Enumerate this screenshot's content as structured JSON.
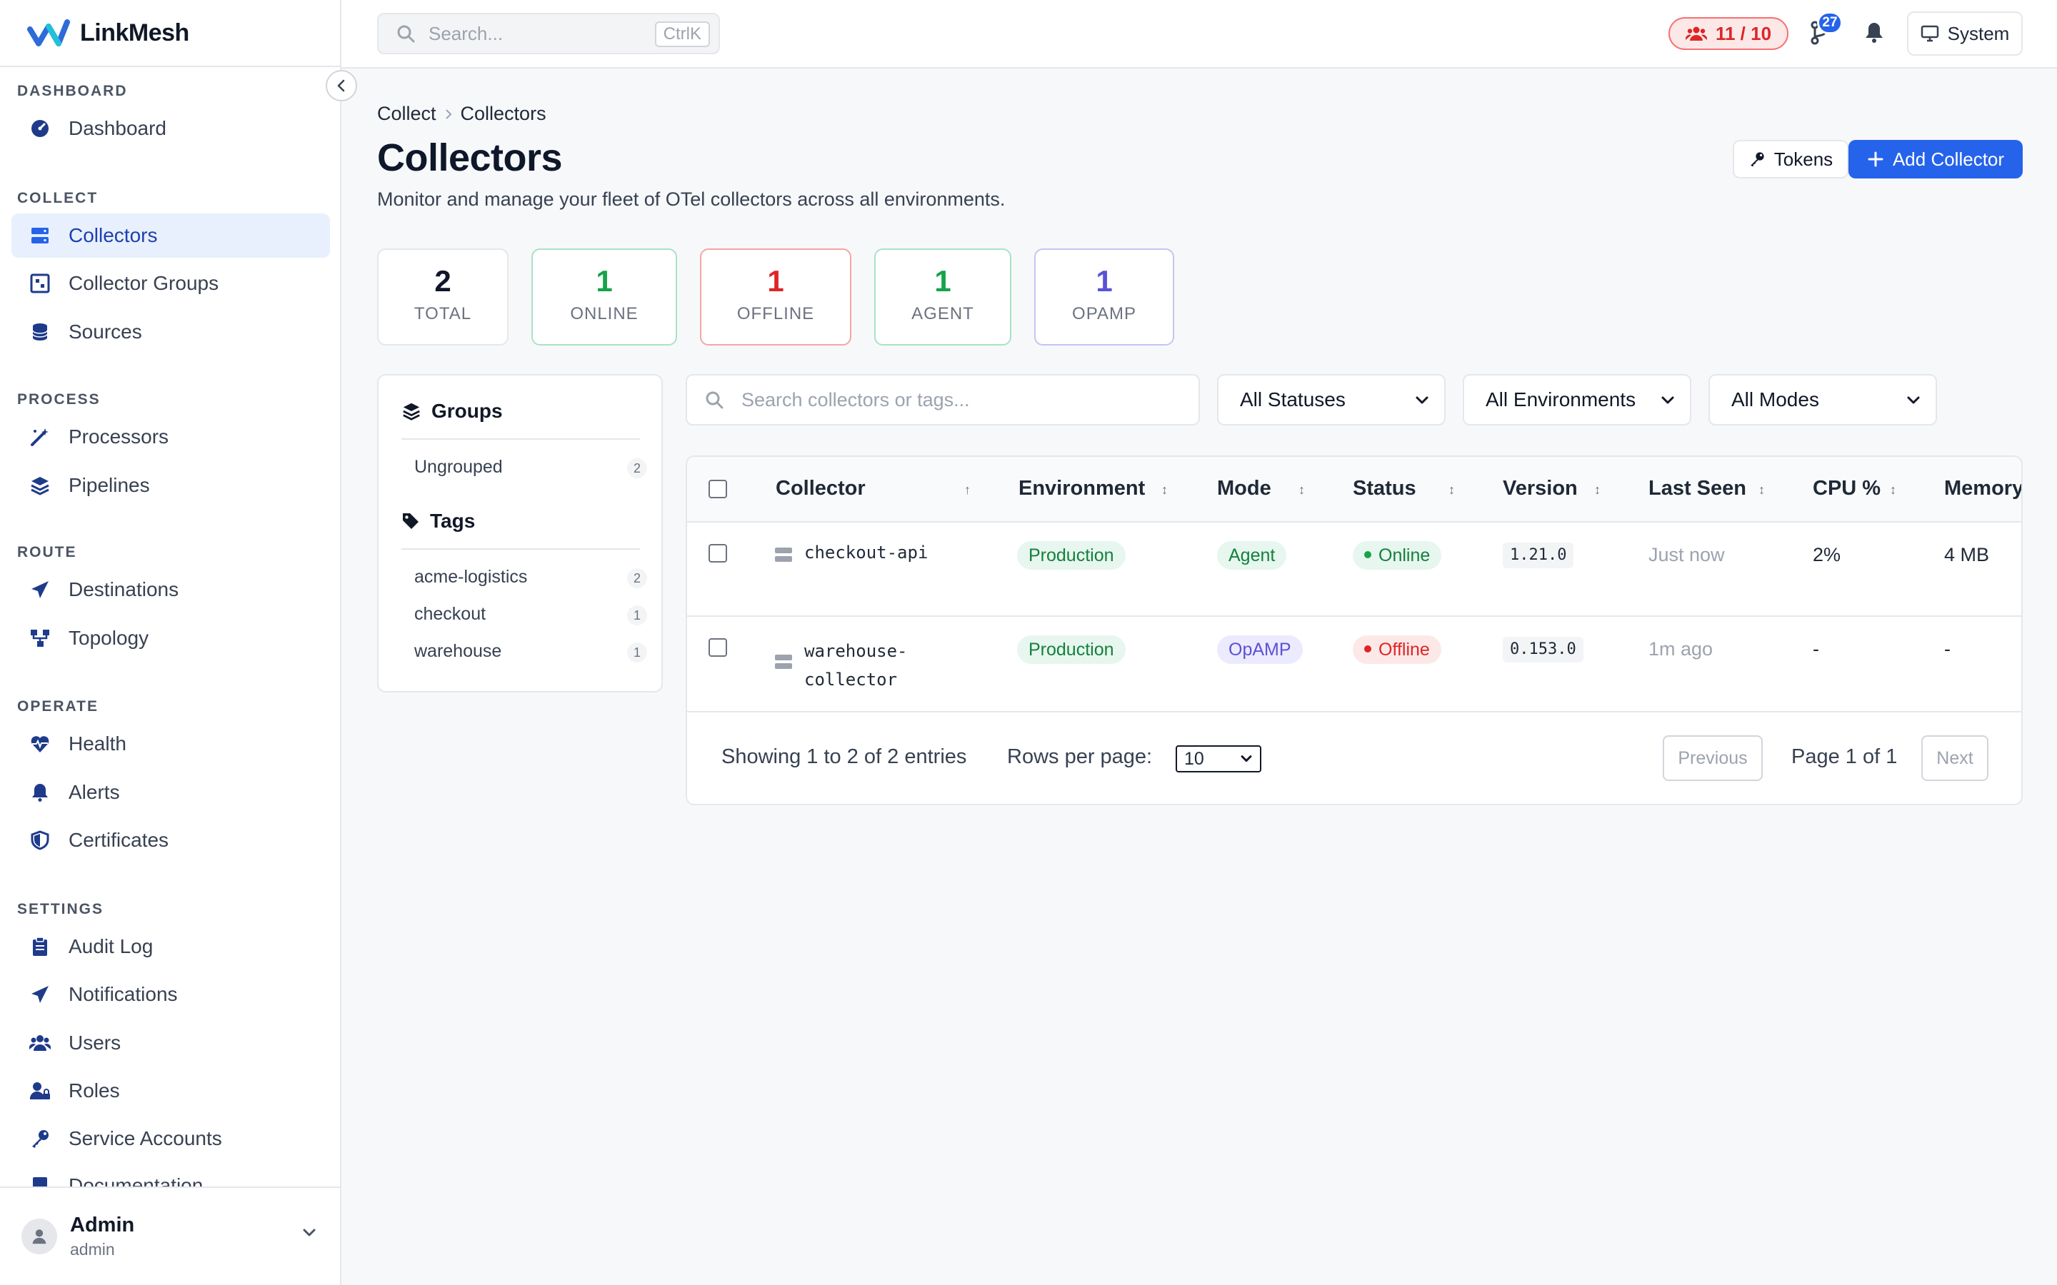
{
  "brand": {
    "name": "LinkMesh"
  },
  "sidebar": {
    "sections": [
      {
        "label": "DASHBOARD"
      },
      {
        "label": "COLLECT"
      },
      {
        "label": "PROCESS"
      },
      {
        "label": "ROUTE"
      },
      {
        "label": "OPERATE"
      },
      {
        "label": "SETTINGS"
      }
    ],
    "items": [
      {
        "label": "Dashboard",
        "icon": "gauge-icon"
      },
      {
        "label": "Collectors",
        "icon": "server-icon",
        "active": true
      },
      {
        "label": "Collector Groups",
        "icon": "group-icon"
      },
      {
        "label": "Sources",
        "icon": "database-icon"
      },
      {
        "label": "Processors",
        "icon": "wand-icon"
      },
      {
        "label": "Pipelines",
        "icon": "layers-icon"
      },
      {
        "label": "Destinations",
        "icon": "paper-plane-icon"
      },
      {
        "label": "Topology",
        "icon": "topology-icon"
      },
      {
        "label": "Health",
        "icon": "heartbeat-icon"
      },
      {
        "label": "Alerts",
        "icon": "bell-icon"
      },
      {
        "label": "Certificates",
        "icon": "shield-icon"
      },
      {
        "label": "Audit Log",
        "icon": "clipboard-icon"
      },
      {
        "label": "Notifications",
        "icon": "paper-plane-icon"
      },
      {
        "label": "Users",
        "icon": "users-icon"
      },
      {
        "label": "Roles",
        "icon": "user-lock-icon"
      },
      {
        "label": "Service Accounts",
        "icon": "key-icon"
      },
      {
        "label": "Documentation",
        "icon": "book-icon"
      }
    ],
    "user": {
      "name": "Admin",
      "sub": "admin"
    }
  },
  "topbar": {
    "search_placeholder": "Search...",
    "search_shortcut": "CtrlK",
    "license": "11 / 10",
    "badge_count": "27",
    "system_label": "System"
  },
  "breadcrumb": {
    "parent": "Collect",
    "current": "Collectors"
  },
  "page": {
    "title": "Collectors",
    "subtitle": "Monitor and manage your fleet of OTel collectors across all environments.",
    "tokens_label": "Tokens",
    "add_label": "Add Collector"
  },
  "stats": [
    {
      "value": "2",
      "label": "TOTAL",
      "color": "#0f172a",
      "border": "#e5e7eb"
    },
    {
      "value": "1",
      "label": "ONLINE",
      "color": "#16a34a",
      "border": "#a7e3c4"
    },
    {
      "value": "1",
      "label": "OFFLINE",
      "color": "#dc2626",
      "border": "#f5a5a5"
    },
    {
      "value": "1",
      "label": "AGENT",
      "color": "#16a34a",
      "border": "#a7e3c4"
    },
    {
      "value": "1",
      "label": "OPAMP",
      "color": "#5b52d6",
      "border": "#c7c3f2"
    }
  ],
  "groups_panel": {
    "groups_title": "Groups",
    "groups": [
      {
        "name": "Ungrouped",
        "count": "2"
      }
    ],
    "tags_title": "Tags",
    "tags": [
      {
        "name": "acme-logistics",
        "count": "2"
      },
      {
        "name": "checkout",
        "count": "1"
      },
      {
        "name": "warehouse",
        "count": "1"
      }
    ]
  },
  "filters": {
    "search_placeholder": "Search collectors or tags...",
    "status": "All Statuses",
    "environment": "All Environments",
    "mode": "All Modes"
  },
  "table": {
    "columns": [
      "Collector",
      "Environment",
      "Mode",
      "Status",
      "Version",
      "Last Seen",
      "CPU %",
      "Memory"
    ],
    "sort_glyphs": {
      "collector": "↑",
      "other": "↕"
    },
    "rows": [
      {
        "name_line1": "checkout-api",
        "name_line2": "",
        "environment": "Production",
        "mode": "Agent",
        "status": "Online",
        "version": "1.21.0",
        "last_seen": "Just now",
        "cpu": "2%",
        "memory": "4 MB"
      },
      {
        "name_line1": "warehouse-",
        "name_line2": "collector",
        "environment": "Production",
        "mode": "OpAMP",
        "status": "Offline",
        "version": "0.153.0",
        "last_seen": "1m ago",
        "cpu": "-",
        "memory": "-"
      }
    ]
  },
  "pagination": {
    "showing": "Showing 1 to 2 of 2 entries",
    "rows_per_page_label": "Rows per page:",
    "rows_per_page": "10",
    "previous": "Previous",
    "page_info": "Page 1 of 1",
    "next": "Next"
  }
}
